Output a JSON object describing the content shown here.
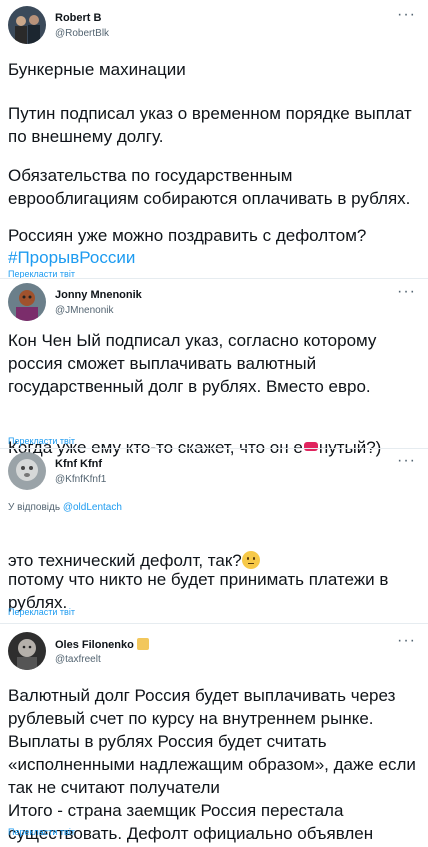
{
  "tweets": [
    {
      "name": "Robert B",
      "handle": "@RobertBlk",
      "more": "···",
      "p1": "Бункерные махинации",
      "p2": "Путин подписал указ о временном порядке выплат по внешнему долгу.",
      "p3": "Обязательства по государственным еврооблигациям собираются оплачивать в рублях.",
      "p4": "Россиян уже можно поздравить с дефолтом?",
      "hashtag": "#ПрорывРоссии",
      "translate": "Перекласти твіт"
    },
    {
      "name": "Jonny Mnenonik",
      "handle": "@JMnenonik",
      "more": "···",
      "p1": "Кон Чен Ый подписал указ, согласно которому россия сможет выплачивать валютный государственный долг в рублях. Вместо евро.",
      "p2a": "Когда уже ему кто-то скажет, что он е",
      "p2b": "нутый?)",
      "translate": "Перекласти твіт"
    },
    {
      "name": "Kfnf Kfnf",
      "handle": "@KfnfKfnf1",
      "more": "···",
      "reply_prefix": "У відповідь",
      "reply_handle": "@oldLentach",
      "p1": "это технический дефолт, так?",
      "p2": "потому что никто не будет принимать платежи в рублях.",
      "translate": "Перекласти твіт"
    },
    {
      "name": "Oles Filonenko",
      "handle": "@taxfreelt",
      "more": "···",
      "p1": "Валютный долг Россия будет выплачивать через рублевый счет по курсу на внутреннем рынке.\nВыплаты в рублях Россия будет считать «исполненными надлежащим образом», даже если так не считают получатели\nИтого - страна заемщик Россия перестала существовать. Дефолт официально объявлен",
      "translate": "Перекласти твіт"
    }
  ],
  "icons": {
    "thinking_emoji": "thinking-face",
    "name_emoji": "person-emoji",
    "censor": "red-censor-mark"
  },
  "colors": {
    "link": "#1d9bf0",
    "secondary": "#536471",
    "text": "#0f1419"
  }
}
